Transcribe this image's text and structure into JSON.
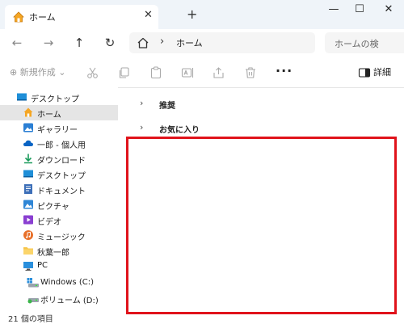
{
  "tab": {
    "title": "ホーム",
    "close_glyph": "✕",
    "new_tab_glyph": "+"
  },
  "window": {
    "minimize_glyph": "—",
    "maximize_glyph": "☐",
    "close_glyph": "✕"
  },
  "nav": {
    "back_glyph": "←",
    "forward_glyph": "→",
    "up_glyph": "↑",
    "refresh_glyph": "↻"
  },
  "address": {
    "separator": "›",
    "text": "ホーム"
  },
  "search": {
    "placeholder": "ホームの検"
  },
  "toolbar": {
    "new_label": "⊕ 新規作成 ⌄",
    "more_glyph": "···",
    "details_label": "詳細"
  },
  "sidebar": {
    "items": [
      {
        "label": "デスクトップ"
      },
      {
        "label": "ホーム"
      },
      {
        "label": "ギャラリー"
      },
      {
        "label": "一郎 - 個人用"
      },
      {
        "label": "ダウンロード"
      },
      {
        "label": "デスクトップ"
      },
      {
        "label": "ドキュメント"
      },
      {
        "label": "ピクチャ"
      },
      {
        "label": "ビデオ"
      },
      {
        "label": "ミュージック"
      },
      {
        "label": "秋葉一郎"
      },
      {
        "label": "PC"
      },
      {
        "label": "Windows (C:)"
      },
      {
        "label": "ボリューム (D:)"
      }
    ]
  },
  "status": {
    "count_text": "21 個の項目"
  },
  "main": {
    "groups": [
      {
        "chevron": "›",
        "label": "推奨"
      },
      {
        "chevron": "›",
        "label": "お気に入り"
      }
    ]
  },
  "colors": {
    "highlight": "#e0131b",
    "selection": "#e5e5e5",
    "accent": "#0067c0"
  }
}
